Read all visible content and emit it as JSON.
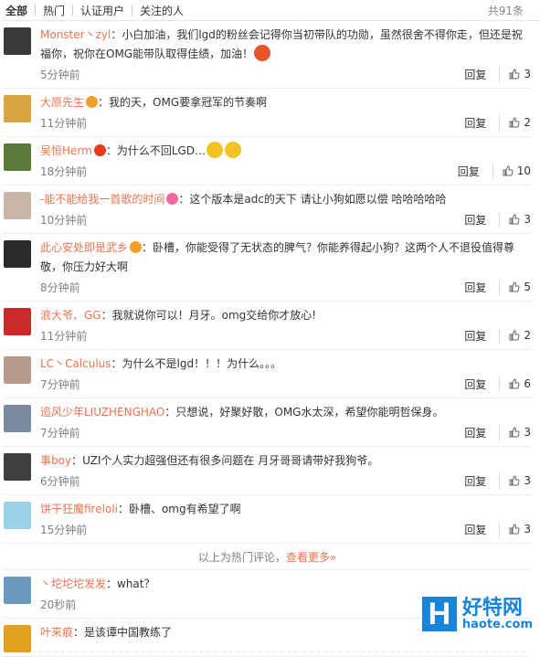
{
  "tabs": [
    {
      "label": "全部",
      "active": true
    },
    {
      "label": "热门"
    },
    {
      "label": "认证用户"
    },
    {
      "label": "关注的人"
    }
  ],
  "total": "共91条",
  "reply_label": "回复",
  "comments": [
    {
      "user": "Monster丶zyl",
      "text": "：小白加油，我们lgd的粉丝会记得你当初带队的功勋，虽然很舍不得你走，但还是祝福你，祝你在OMG能带队取得佳绩，加油！",
      "time": "5分钟前",
      "likes": "3",
      "avatar_color": "#3a3a3a",
      "badge_color": "",
      "emoji": [
        "#e8552b"
      ]
    },
    {
      "user": "大原先生",
      "text": "：我的天，OMG要拿冠军的节奏啊",
      "time": "11分钟前",
      "likes": "2",
      "avatar_color": "#d9a441",
      "badge_color": "#f0a02a",
      "emoji": []
    },
    {
      "user": "吴恒Herm",
      "text": "：为什么不回LGD…",
      "time": "18分钟前",
      "likes": "10",
      "avatar_color": "#5a7a3a",
      "badge_color": "#e83a1a",
      "emoji": [
        "#f3c325",
        "#f3c325"
      ]
    },
    {
      "user": "-能不能给我一首歌的时间",
      "text": "：这个版本是adc的天下 请让小狗如愿以偿 哈哈哈哈哈",
      "time": "10分钟前",
      "likes": "3",
      "avatar_color": "#c8b7a8",
      "badge_color": "#f06aa0",
      "emoji": []
    },
    {
      "user": "此心安处即是武乡",
      "text": "：卧槽，你能受得了无状态的脾气？你能养得起小狗？这两个人不退役值得尊敬，你压力好大啊",
      "time": "8分钟前",
      "likes": "5",
      "avatar_color": "#2a2a2a",
      "badge_color": "#f0a02a",
      "emoji": []
    },
    {
      "user": "浪大爷、GG",
      "text": "：我就说你可以！月牙。omg交给你才放心!",
      "time": "11分钟前",
      "likes": "2",
      "avatar_color": "#cc2a2a",
      "badge_color": "",
      "emoji": []
    },
    {
      "user": "LC丶Calculus",
      "text": "：为什么不是lgd！！！为什么。。。",
      "time": "7分钟前",
      "likes": "6",
      "avatar_color": "#b89a8a",
      "badge_color": "",
      "emoji": []
    },
    {
      "user": "追风少年LIUZHENGHAO",
      "text": "：只想说，好聚好散，OMG水太深，希望你能明哲保身。",
      "time": "7分钟前",
      "likes": "3",
      "avatar_color": "#7a8aa0",
      "badge_color": "",
      "emoji": []
    },
    {
      "user": "事boy",
      "text": "：UZI个人实力超强但还有很多问题在 月牙哥哥请带好我狗爷。",
      "time": "6分钟前",
      "likes": "3",
      "avatar_color": "#404040",
      "badge_color": "",
      "emoji": []
    },
    {
      "user": "饼干狂魔fireloli",
      "text": "：卧槽、omg有希望了啊",
      "time": "15分钟前",
      "likes": "3",
      "avatar_color": "#9ad0e8",
      "badge_color": "",
      "emoji": []
    }
  ],
  "hot_footer": {
    "text": "以上为热门评论，",
    "more": "查看更多»"
  },
  "recent": [
    {
      "user": "丶坨坨坨发发",
      "text": "：what？",
      "time": "20秒前",
      "avatar_color": "#6a9ac0"
    },
    {
      "user": "叶来痕",
      "text": "：是该谭中国教练了",
      "time": "",
      "avatar_color": "#e0a020"
    }
  ],
  "watermark": {
    "logo": "H",
    "cn": "好特网",
    "url": "haote.com"
  }
}
